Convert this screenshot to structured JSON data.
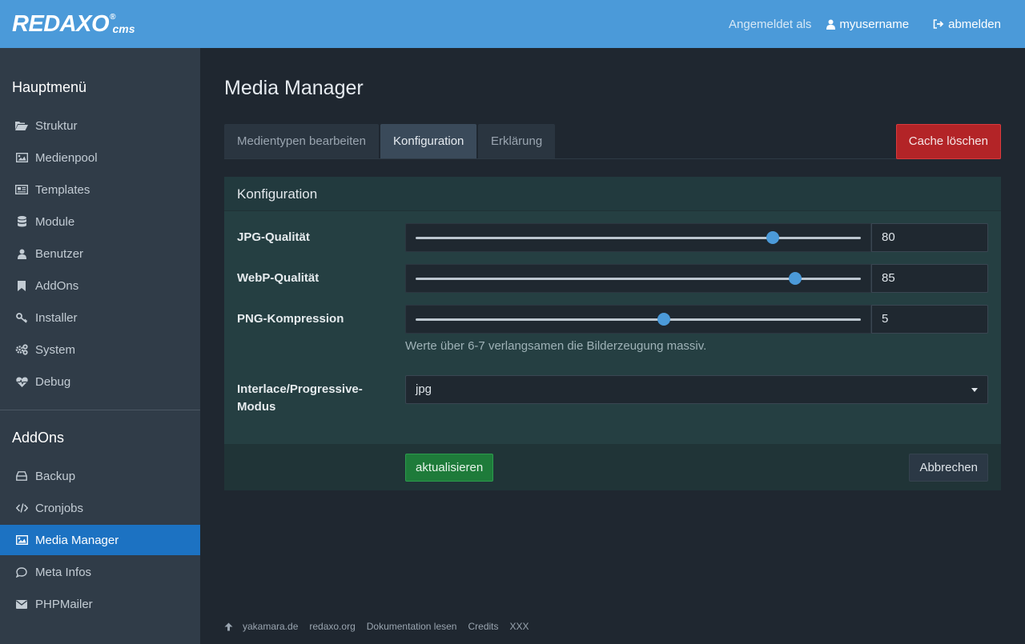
{
  "brand": {
    "logo_text": "REDAXO",
    "logo_reg": "®",
    "logo_cms": "cms"
  },
  "topbar": {
    "logged_in_as": "Angemeldet als",
    "username": "myusername",
    "logout": "abmelden"
  },
  "sidebar": {
    "main_heading": "Hauptmenü",
    "main_items": [
      {
        "label": "Struktur",
        "icon": "folder-open-icon"
      },
      {
        "label": "Medienpool",
        "icon": "image-icon"
      },
      {
        "label": "Templates",
        "icon": "newspaper-icon"
      },
      {
        "label": "Module",
        "icon": "database-icon"
      },
      {
        "label": "Benutzer",
        "icon": "user-icon"
      },
      {
        "label": "AddOns",
        "icon": "bookmark-icon"
      },
      {
        "label": "Installer",
        "icon": "key-icon"
      },
      {
        "label": "System",
        "icon": "cogs-icon"
      },
      {
        "label": "Debug",
        "icon": "heartbeat-icon"
      }
    ],
    "addons_heading": "AddOns",
    "addon_items": [
      {
        "label": "Backup",
        "icon": "hdd-icon"
      },
      {
        "label": "Cronjobs",
        "icon": "code-icon"
      },
      {
        "label": "Media Manager",
        "icon": "image-icon",
        "active": true
      },
      {
        "label": "Meta Infos",
        "icon": "comment-icon"
      },
      {
        "label": "PHPMailer",
        "icon": "envelope-icon"
      }
    ]
  },
  "main": {
    "title": "Media Manager",
    "tabs": [
      {
        "label": "Medientypen bearbeiten"
      },
      {
        "label": "Konfiguration",
        "active": true
      },
      {
        "label": "Erklärung"
      }
    ],
    "clear_cache": "Cache löschen",
    "panel": {
      "title": "Konfiguration",
      "jpg": {
        "label": "JPG-Qualität",
        "value": "80",
        "min": 0,
        "max": 100
      },
      "webp": {
        "label": "WebP-Qualität",
        "value": "85",
        "min": 0,
        "max": 100
      },
      "png": {
        "label": "PNG-Kompression",
        "value": "5",
        "min": 0,
        "max": 9
      },
      "png_help": "Werte über 6-7 verlangsamen die Bilderzeugung massiv.",
      "interlace": {
        "label": "Interlace/Progressive-Modus",
        "value": "jpg"
      },
      "save": "aktualisieren",
      "abort": "Abbrechen"
    }
  },
  "footer": {
    "links": [
      "yakamara.de",
      "redaxo.org",
      "Dokumentation lesen",
      "Credits",
      "XXX"
    ]
  },
  "colors": {
    "topbar": "#4b9ad9",
    "sidebar": "#303c48",
    "active_nav": "#1c72c2",
    "danger": "#b32427",
    "success": "#1e7b3a"
  }
}
